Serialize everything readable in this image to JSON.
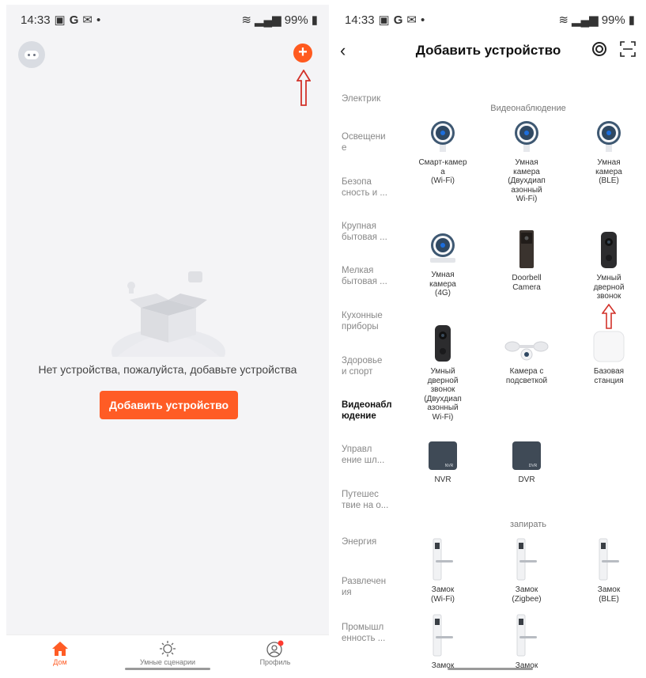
{
  "left": {
    "status": {
      "time": "14:33",
      "g": "G",
      "battery": "99%"
    },
    "empty_message": "Нет устройства, пожалуйста, добавьте устройства",
    "add_button": "Добавить устройство",
    "tabs": [
      {
        "label": "Дом",
        "icon": "home-icon"
      },
      {
        "label": "Умные сценарии",
        "icon": "sun-icon"
      },
      {
        "label": "Профиль",
        "icon": "profile-icon"
      }
    ],
    "accent": "#ff5c25"
  },
  "right": {
    "status": {
      "time": "14:33",
      "g": "G",
      "battery": "99%"
    },
    "title": "Добавить устройство",
    "sidebar": [
      "Электрик",
      "Освещени\nе",
      "Безопа\nсность и ...",
      "Крупная\nбытовая ...",
      "Мелкая\nбытовая ...",
      "Кухонные\nприборы",
      "Здоровье\nи спорт",
      "Видеонабл\nюдение",
      "Управл\nение шл...",
      "Путешес\nтвие на о...",
      "Энергия",
      "Развлечен\nия",
      "Промышл\nенность ..."
    ],
    "active_sidebar_index": 7,
    "section_video": "Видеонаблюдение",
    "devices_video": [
      "Смарт-камер\nа\n(Wi-Fi)",
      "Умная\nкамера\n(Двухдиап\nазонный\nWi-Fi)",
      "Умная\nкамера\n(BLE)",
      "Умная\nкамера\n(4G)",
      "Doorbell\nCamera",
      "Умный\nдверной\nзвонок",
      "Умный\nдверной\nзвонок\n(Двухдиап\nазонный\nWi-Fi)",
      "Камера с\nподсветкой",
      "Базовая\nстанция",
      "NVR",
      "DVR"
    ],
    "nvr_tag": "NVR",
    "dvr_tag": "DVR",
    "section_lock": "запирать",
    "devices_lock": [
      "Замок\n(Wi-Fi)",
      "Замок\n(Zigbee)",
      "Замок\n(BLE)",
      "Замок",
      "Замок"
    ]
  }
}
